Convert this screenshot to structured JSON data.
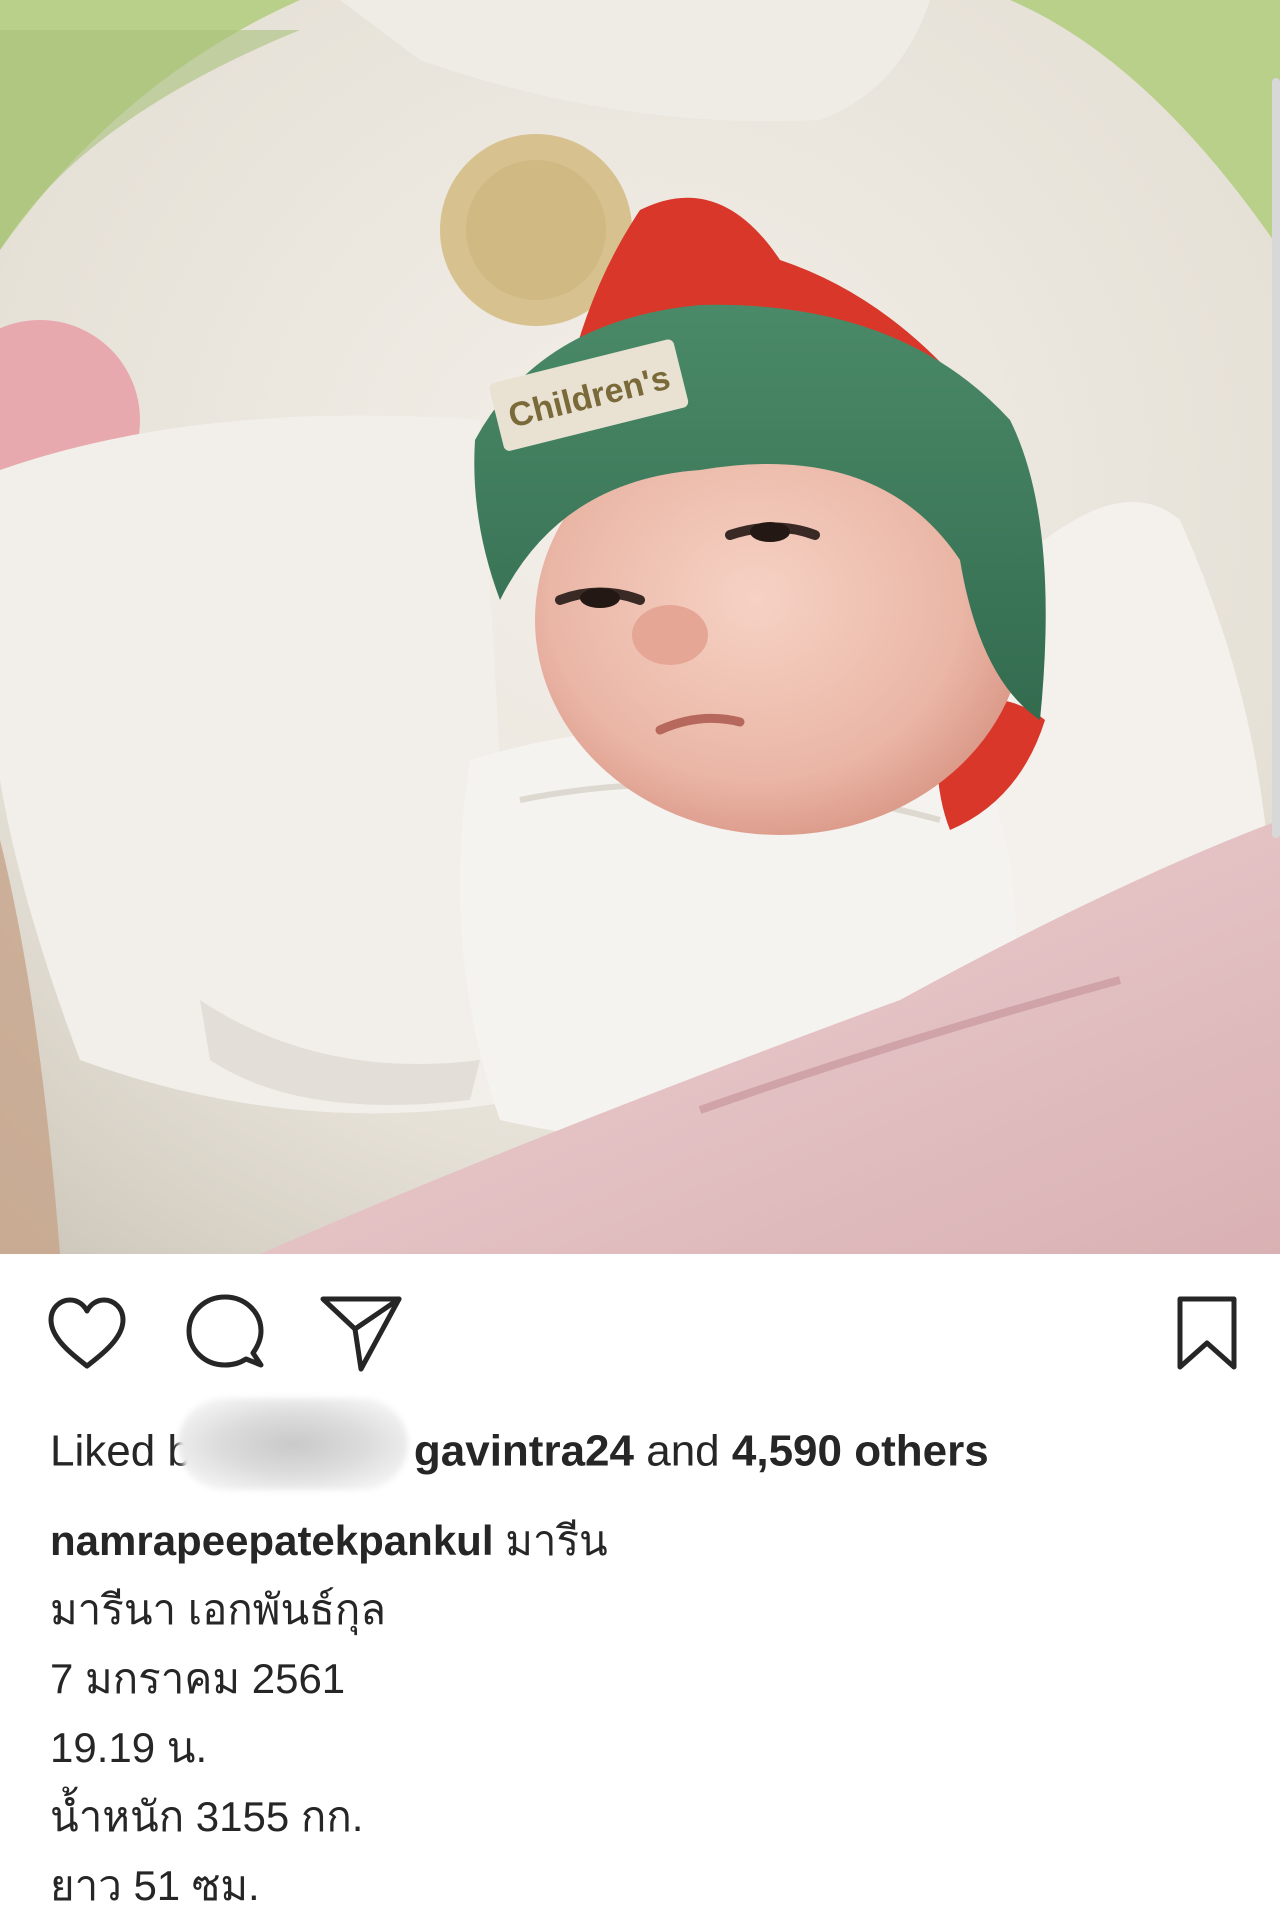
{
  "post": {
    "image_alt": "newborn baby in green and red knit hat swaddled in white blanket",
    "photo_hat_label": "Children's"
  },
  "actions": {
    "like": "heart-icon",
    "comment": "comment-icon",
    "share": "send-icon",
    "save": "bookmark-icon"
  },
  "likes": {
    "prefix": "Liked b",
    "user": "gavintra24",
    "connector": "and",
    "count": "4,590 others"
  },
  "caption": {
    "username": "namrapeepatekpankul",
    "first_line_text": "มารีน",
    "lines": [
      "มารีนา เอกพันธ์กุล",
      "7 มกราคม 2561",
      "19.19 น.",
      "น้ำหนัก 3155 กก.",
      "ยาว 51 ซม."
    ]
  },
  "colors": {
    "text": "#262626",
    "hat_green": "#3f7d5c",
    "hat_red": "#d8372a",
    "blanket_pink": "#e6c3c6"
  }
}
